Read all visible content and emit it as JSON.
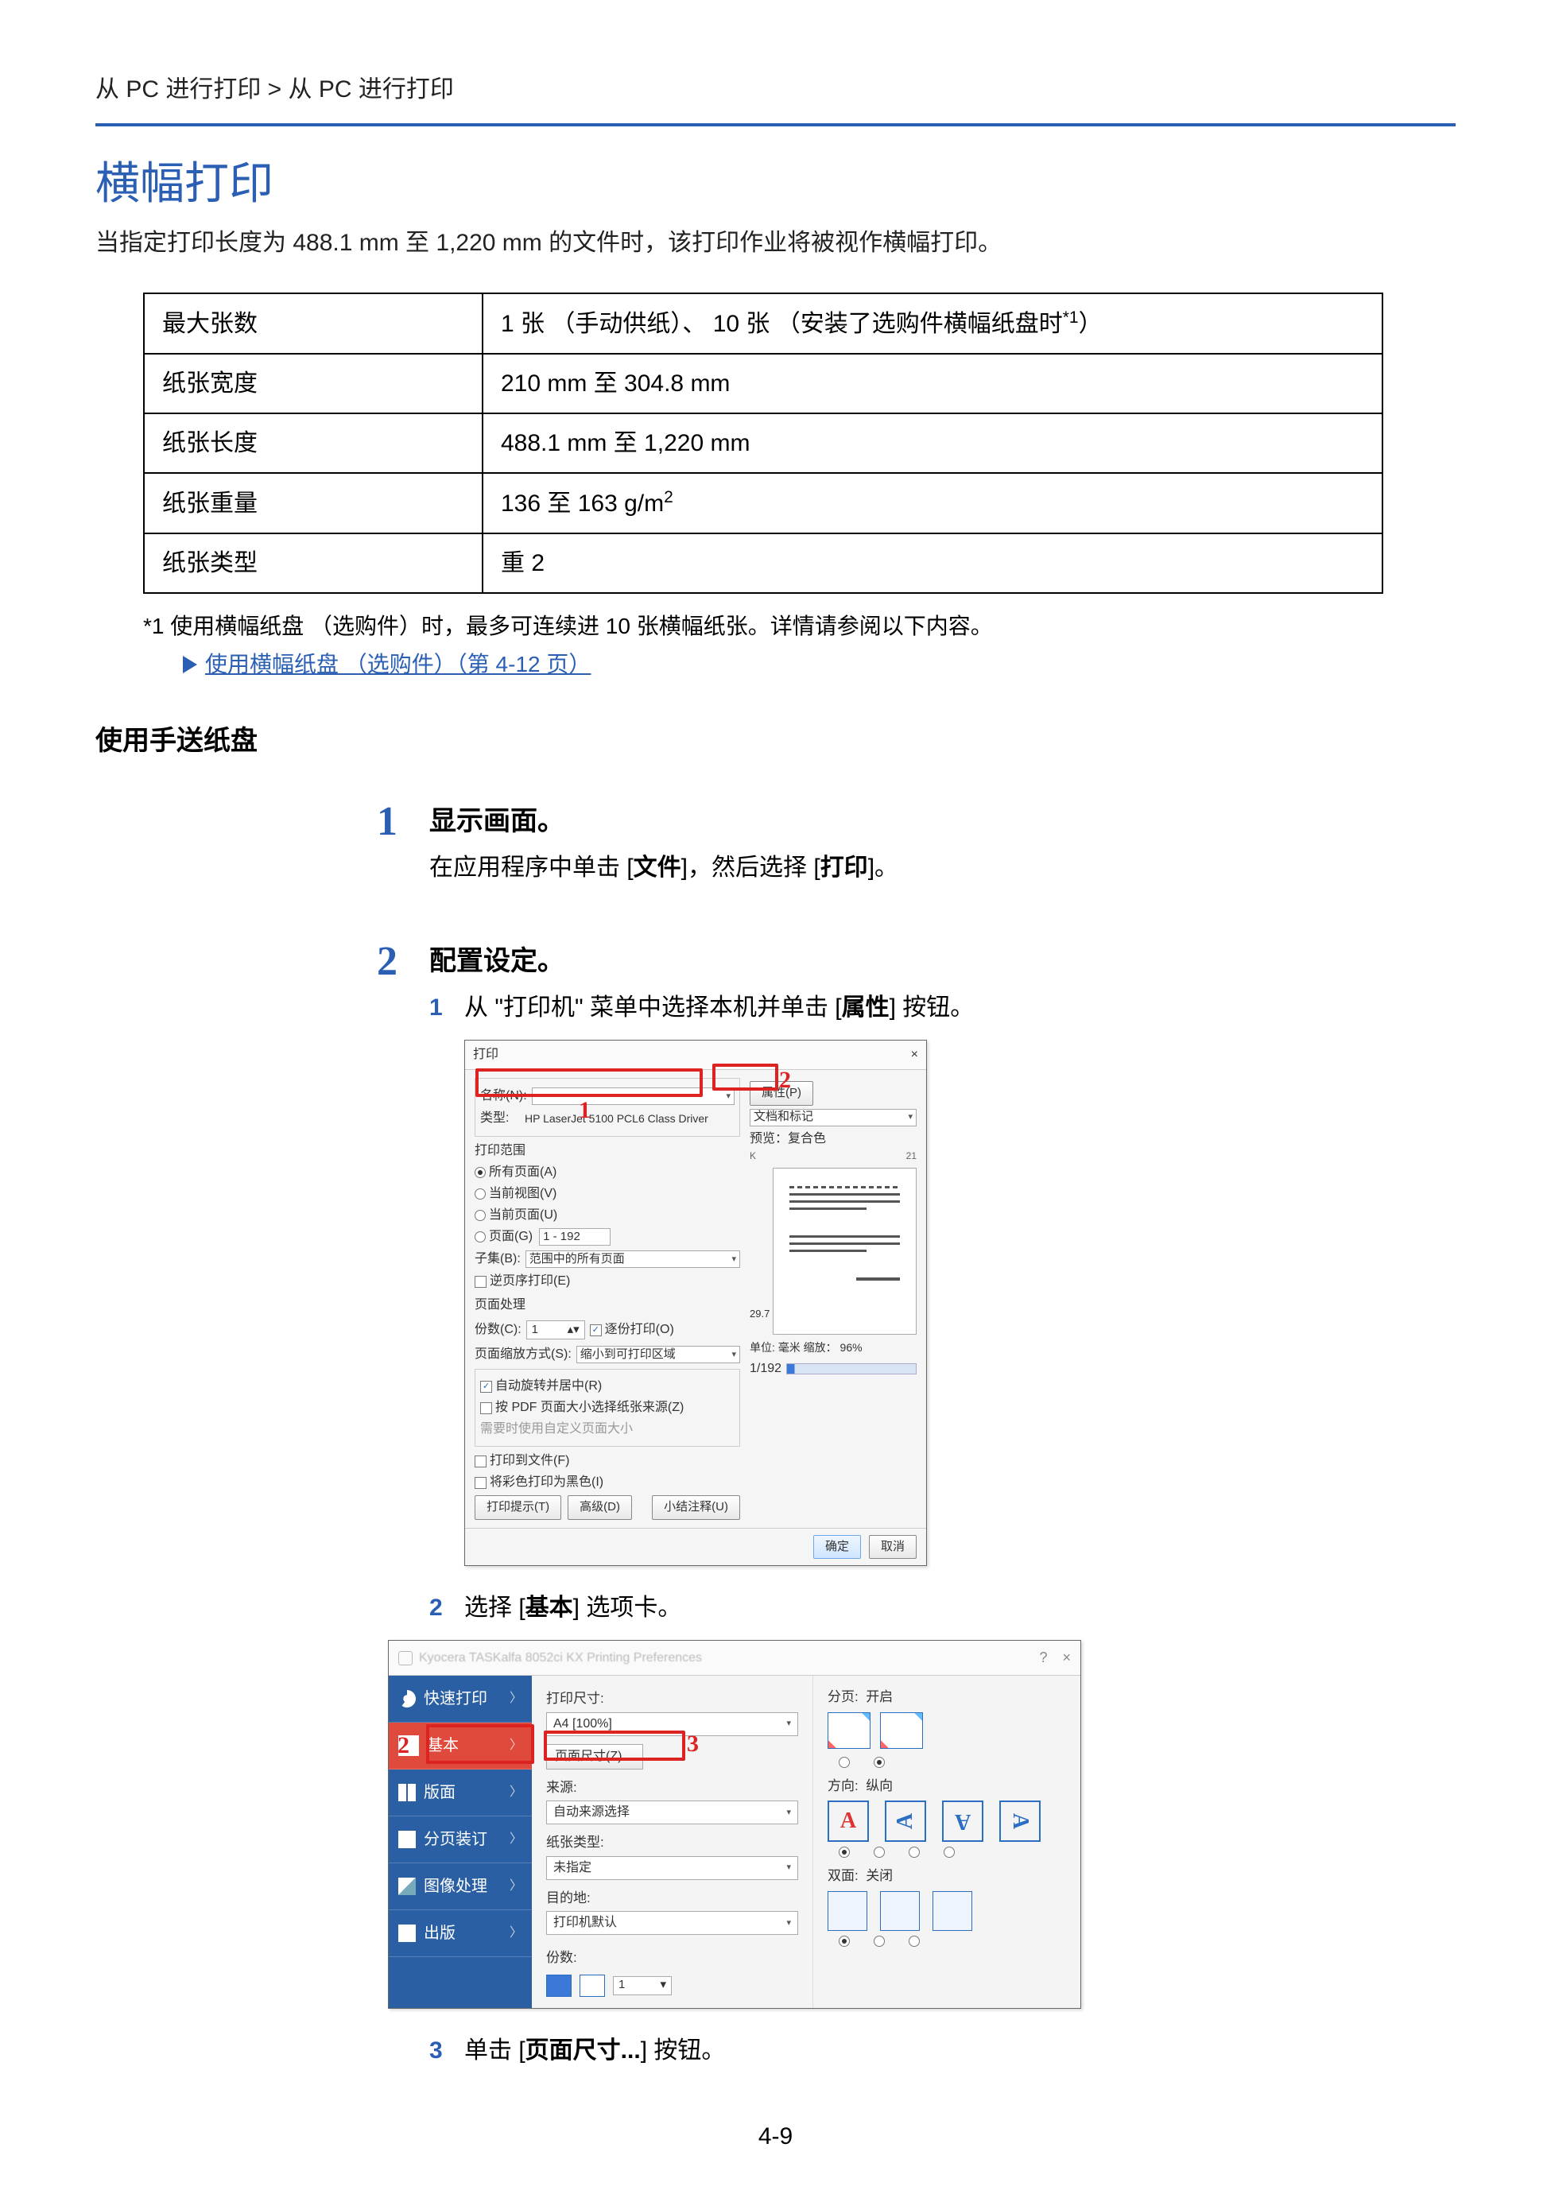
{
  "breadcrumb": "从 PC 进行打印 > 从 PC 进行打印",
  "h1": "横幅打印",
  "intro": "当指定打印长度为 488.1 mm 至 1,220 mm 的文件时，该打印作业将被视作横幅打印。",
  "spec_table": {
    "rows": [
      {
        "label": "最大张数",
        "value": "1 张 （手动供纸）、 10 张 （安装了选购件横幅纸盘时",
        "sup": "*1",
        "value_tail": "）"
      },
      {
        "label": "纸张宽度",
        "value": "210 mm 至 304.8 mm"
      },
      {
        "label": "纸张长度",
        "value": "488.1 mm 至 1,220 mm"
      },
      {
        "label": "纸张重量",
        "value": "136 至 163 g/m",
        "sup": "2"
      },
      {
        "label": "纸张类型",
        "value": "重 2"
      }
    ]
  },
  "footnote1": "*1  使用横幅纸盘 （选购件）时，最多可连续进 10 张横幅纸张。详情请参阅以下内容。",
  "footnote_link": "使用横幅纸盘 （选购件）（第 4-12 页）",
  "subhead": "使用手送纸盘",
  "step1": {
    "num": "1",
    "title": "显示画面。",
    "desc_a": "在应用程序中单击 [",
    "desc_b": "文件",
    "desc_c": "]，然后选择 [",
    "desc_d": "打印",
    "desc_e": "]。"
  },
  "step2": {
    "num": "2",
    "title": "配置设定。",
    "sub1_a": "从 \"打印机\" 菜单中选择本机并单击 [",
    "sub1_b": "属性",
    "sub1_c": "] 按钮。",
    "sub2_a": "选择 [",
    "sub2_b": "基本",
    "sub2_c": "] 选项卡。",
    "sub3_a": "单击 [",
    "sub3_b": "页面尺寸...",
    "sub3_c": "] 按钮。"
  },
  "dlg1": {
    "title": "打印",
    "close": "×",
    "name_lbl": "名称(N):",
    "name_val": "",
    "prop_btn": "属性(P)",
    "type_lbl": "类型:",
    "type_val": "HP LaserJet 5100 PCL6 Class Driver",
    "docrec_lbl": "文档和标记",
    "range_grp": "打印范围",
    "opt_all": "所有页面(A)",
    "opt_cur": "当前视图(V)",
    "opt_curpage": "当前页面(U)",
    "opt_pages": "页面(G)",
    "pages_val": "1 - 192",
    "subset_lbl": "子集(B):",
    "subset_val": "范围中的所有页面",
    "reverse": "逆页序打印(E)",
    "handle_grp": "页面处理",
    "copies_lbl": "份数(C):",
    "copies_val": "1",
    "collate": "逐份打印(O)",
    "scale_lbl": "页面缩放方式(S):",
    "scale_val": "缩小到可打印区域",
    "auto_rotate": "自动旋转并居中(R)",
    "fit_pdf": "按 PDF 页面大小选择纸张来源(Z)",
    "custom_size": "   需要时使用自定义页面大小",
    "preview_lbl": "预览：复合色",
    "scale_meta": "单位: 毫米 缩放： 96%",
    "page_counter": "1/192",
    "print_to_file": "打印到文件(F)",
    "color_as_black": "将彩色打印为黑色(I)",
    "hint_btn": "打印提示(T)",
    "adv_btn": "高级(D)",
    "summary_btn": "小结注释(U)",
    "ok": "确定",
    "cancel": "取消",
    "k_line": "K",
    "k_val": "21",
    "height": "29.7"
  },
  "dlg2": {
    "title": "Kyocera TASKalfa 8052ci KX Printing Preferences",
    "q": "?",
    "close": "×",
    "side": {
      "quick": "快速打印",
      "basic": "基本",
      "layout": "版面",
      "booklet": "分页装订",
      "image": "图像处理",
      "output": "出版"
    },
    "mid": {
      "printsize_lbl": "打印尺寸:",
      "printsize_val": "A4   [100%]",
      "pagesize_btn": "页面尺寸(Z)…",
      "source_lbl": "来源:",
      "auto_source_lbl": "自动来源选择",
      "papertype_lbl": "纸张类型:",
      "papertype_val": "未指定",
      "dest_lbl": "目的地:",
      "dest_val": "打印机默认",
      "copies_lbl": "份数:",
      "copies_val": "1"
    },
    "right": {
      "pages_lbl": "分页:",
      "pages_on": "开启",
      "orient_lbl": "方向:",
      "orient_val": "纵向",
      "duplex_lbl": "双面:",
      "duplex_val": "关闭"
    }
  },
  "callouts": {
    "c1": "1",
    "c2": "2",
    "c3": "3"
  },
  "page_number": "4-9"
}
